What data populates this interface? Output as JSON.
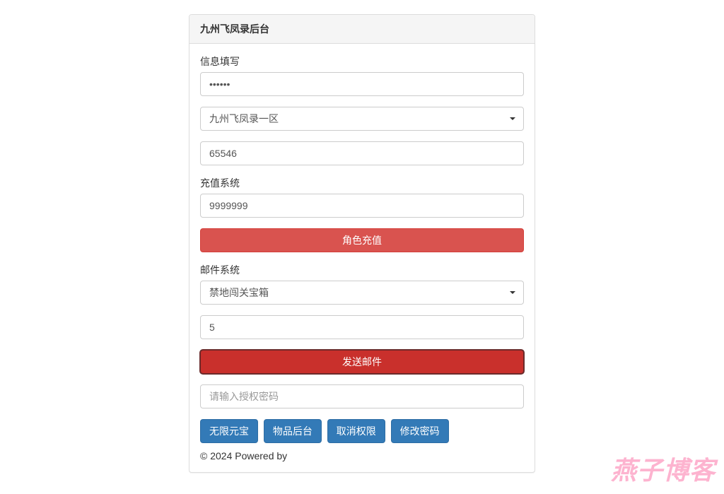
{
  "panel": {
    "title": "九州飞凤录后台"
  },
  "info": {
    "label": "信息填写",
    "password_value": "••••••",
    "region_value": "九州飞凤录一区",
    "id_value": "65546"
  },
  "recharge": {
    "label": "充值系统",
    "amount_value": "9999999",
    "button_label": "角色充值"
  },
  "mail": {
    "label": "邮件系统",
    "item_value": "禁地闯关宝箱",
    "count_value": "5",
    "button_label": "发送邮件"
  },
  "auth": {
    "placeholder": "请输入授权密码"
  },
  "actions": {
    "unlimited_gold": "无限元宝",
    "item_backend": "物品后台",
    "cancel_perm": "取消权限",
    "change_password": "修改密码"
  },
  "footer": "© 2024 Powered by",
  "watermark": "燕子博客"
}
